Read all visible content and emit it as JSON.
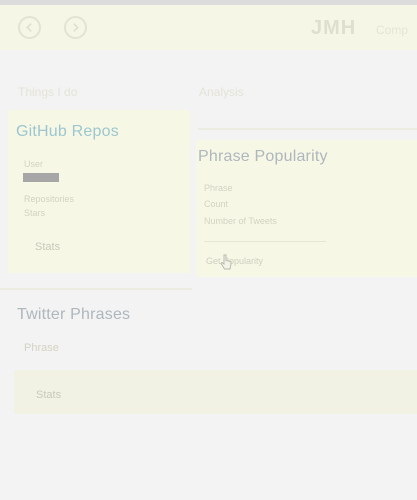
{
  "header": {
    "logo": "JMH",
    "link": "Comp"
  },
  "left": {
    "section_label": "Things I do",
    "github": {
      "title": "GitHub Repos",
      "field_label": "User",
      "field_value": "",
      "line2": "Repositories",
      "line3": "Stars",
      "button": "Stats"
    },
    "twitter": {
      "title": "Twitter Phrases",
      "field_label": "Phrase",
      "button": "Stats"
    }
  },
  "right": {
    "section_label": "Analysis",
    "popularity": {
      "title": "Phrase Popularity",
      "line1": "Phrase",
      "line2": "Count",
      "line3": "Number of Tweets",
      "line4": "",
      "line5": "Get Popularity"
    }
  },
  "colors": {
    "accent": "#9cc7cf",
    "panel": "#f7f7e6",
    "background": "#f3f3f3"
  }
}
